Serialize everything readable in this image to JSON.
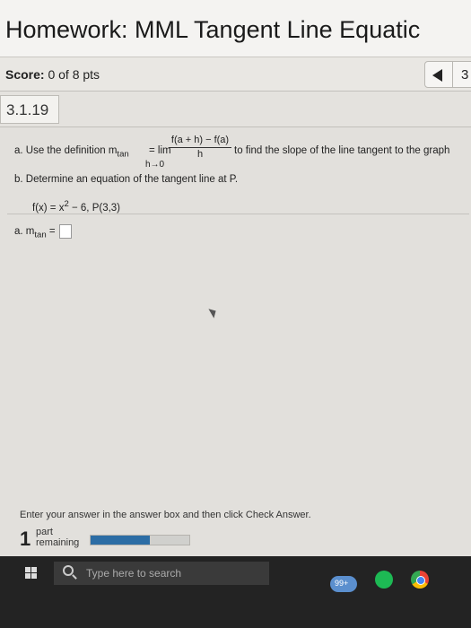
{
  "header": {
    "title": "Homework: MML Tangent Line Equatic"
  },
  "score": {
    "label": "Score:",
    "value": "0 of 8 pts"
  },
  "nav": {
    "question_number": "3"
  },
  "question": {
    "id": "3.1.19",
    "part_a_prefix": "a. Use the definition m",
    "part_a_sub": "tan",
    "lim": "= lim",
    "fraction_num": "f(a + h) − f(a)",
    "fraction_den": "h",
    "limit_under": "h→0",
    "part_a_rest": "to find the slope of the line tangent to the graph",
    "part_b": "b. Determine an equation of the tangent line at P.",
    "function": "f(x) = x",
    "function_exp": "2",
    "function_rest": " − 6, P(3,3)",
    "answer_label": "a. m",
    "answer_sub": "tan",
    "answer_eq": "="
  },
  "instructions": {
    "text": "Enter your answer in the answer box and then click Check Answer."
  },
  "progress": {
    "count": "1",
    "line1": "part",
    "line2": "remaining",
    "fraction": 0.6
  },
  "taskbar": {
    "search_placeholder": "Type here to search",
    "badge": "99+"
  }
}
